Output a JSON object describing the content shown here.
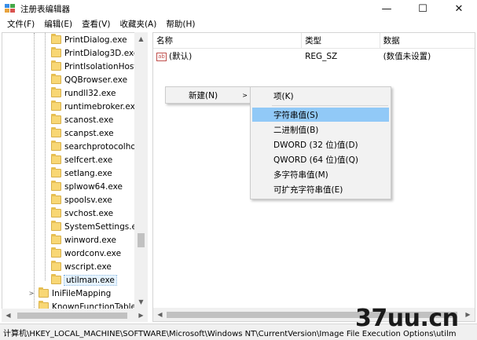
{
  "window": {
    "title": "注册表编辑器",
    "minimize": "—",
    "maximize": "☐",
    "close": "✕"
  },
  "menubar": [
    {
      "label": "文件(F)"
    },
    {
      "label": "编辑(E)"
    },
    {
      "label": "查看(V)"
    },
    {
      "label": "收藏夹(A)"
    },
    {
      "label": "帮助(H)"
    }
  ],
  "tree": {
    "items": [
      {
        "label": "PrintDialog.exe"
      },
      {
        "label": "PrintDialog3D.exe"
      },
      {
        "label": "PrintIsolationHost"
      },
      {
        "label": "QQBrowser.exe"
      },
      {
        "label": "rundll32.exe"
      },
      {
        "label": "runtimebroker.exe"
      },
      {
        "label": "scanost.exe"
      },
      {
        "label": "scanpst.exe"
      },
      {
        "label": "searchprotocolho"
      },
      {
        "label": "selfcert.exe"
      },
      {
        "label": "setlang.exe"
      },
      {
        "label": "splwow64.exe"
      },
      {
        "label": "spoolsv.exe"
      },
      {
        "label": "svchost.exe"
      },
      {
        "label": "SystemSettings.ex"
      },
      {
        "label": "winword.exe"
      },
      {
        "label": "wordconv.exe"
      },
      {
        "label": "wscript.exe"
      },
      {
        "label": "utilman.exe"
      }
    ],
    "siblings": [
      {
        "label": "IniFileMapping"
      },
      {
        "label": "KnownFunctionTableI"
      }
    ]
  },
  "list": {
    "columns": [
      "名称",
      "类型",
      "数据"
    ],
    "rows": [
      {
        "icon": "ab",
        "name": "(默认)",
        "type": "REG_SZ",
        "data": "(数值未设置)"
      }
    ]
  },
  "context_menu": {
    "new_label": "新建(N)",
    "submenu": [
      {
        "label": "项(K)"
      },
      {
        "label": "字符串值(S)"
      },
      {
        "label": "二进制值(B)"
      },
      {
        "label": "DWORD (32 位)值(D)"
      },
      {
        "label": "QWORD (64 位)值(Q)"
      },
      {
        "label": "多字符串值(M)"
      },
      {
        "label": "可扩充字符串值(E)"
      }
    ]
  },
  "statusbar": {
    "path": "计算机\\HKEY_LOCAL_MACHINE\\SOFTWARE\\Microsoft\\Windows NT\\CurrentVersion\\Image File Execution Options\\utilm"
  },
  "watermark": {
    "text": "37uu.cn"
  },
  "colors": {
    "highlight": "#91c9f7",
    "folder": "#f8d775",
    "menu_bg": "#f2f2f2"
  }
}
